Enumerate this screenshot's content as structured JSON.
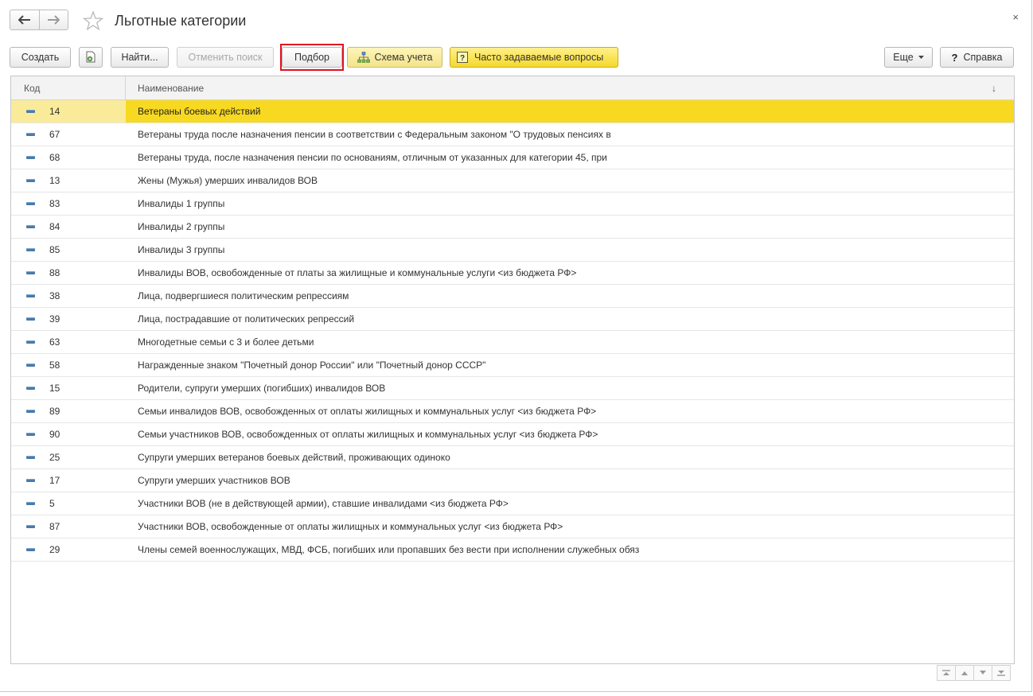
{
  "window": {
    "title": "Льготные категории",
    "close_label": "×"
  },
  "toolbar": {
    "create_label": "Создать",
    "find_label": "Найти...",
    "cancel_search_label": "Отменить поиск",
    "selection_label": "Подбор",
    "accounting_scheme_label": "Схема учета",
    "faq_label": "Часто задаваемые вопросы",
    "more_label": "Еще",
    "help_label": "Справка"
  },
  "table": {
    "columns": {
      "code": "Код",
      "name": "Наименование",
      "sort_indicator": "↓"
    },
    "rows": [
      {
        "code": "14",
        "name": "Ветераны боевых действий"
      },
      {
        "code": "67",
        "name": "Ветераны труда после назначения  пенсии в соответствии с Федеральным законом  \"О трудовых пенсиях в"
      },
      {
        "code": "68",
        "name": "Ветераны труда, после назначения пенсии по основаниям, отличным от указанных для  категории 45,  при"
      },
      {
        "code": "13",
        "name": "Жены (Мужья) умерших инвалидов ВОВ"
      },
      {
        "code": "83",
        "name": "Инвалиды 1 группы"
      },
      {
        "code": "84",
        "name": "Инвалиды 2 группы"
      },
      {
        "code": "85",
        "name": "Инвалиды 3 группы"
      },
      {
        "code": "88",
        "name": "Инвалиды ВОВ, освобожденные от платы за жилищные и коммунальные услуги <из бюджета РФ>"
      },
      {
        "code": "38",
        "name": "Лица, подвергшиеся политическим репрессиям"
      },
      {
        "code": "39",
        "name": "Лица, пострадавшие от политических репрессий"
      },
      {
        "code": "63",
        "name": "Многодетные семьи с 3 и более детьми"
      },
      {
        "code": "58",
        "name": "Награжденные знаком \"Почетный донор России\" или \"Почетный донор СССР\""
      },
      {
        "code": "15",
        "name": "Родители, супруги умерших (погибших) инвалидов ВОВ"
      },
      {
        "code": "89",
        "name": "Семьи инвалидов ВОВ, освобожденных от оплаты жилищных и коммунальных услуг <из бюджета РФ>"
      },
      {
        "code": "90",
        "name": "Семьи участников ВОВ, освобожденных от оплаты жилищных и коммунальных услуг <из бюджета РФ>"
      },
      {
        "code": "25",
        "name": "Супруги умерших ветеранов боевых действий, проживающих одиноко"
      },
      {
        "code": "17",
        "name": "Супруги умерших участников ВОВ"
      },
      {
        "code": "5",
        "name": "Участники ВОВ (не в действующей армии), ставшие инвалидами <из бюджета РФ>"
      },
      {
        "code": "87",
        "name": "Участники ВОВ, освобожденные от оплаты жилищных и коммунальных услуг <из бюджета РФ>"
      },
      {
        "code": "29",
        "name": "Члены семей военнослужащих, МВД, ФСБ, погибших или пропавших без вести при исполнении служебных обяз"
      }
    ],
    "selected_index": 0
  },
  "colors": {
    "selected_row": "#f8d921",
    "selected_code_cell": "#faeb9a",
    "highlight_frame": "#e3101d",
    "faq_button": "#f5d92b"
  },
  "icons": {
    "back": "arrow-left-icon",
    "forward": "arrow-right-icon",
    "favorite": "star-icon",
    "copy": "copy-document-icon",
    "scheme": "hierarchy-icon",
    "faq": "question-box-icon",
    "more": "dropdown-caret-icon",
    "help": "question-mark-icon",
    "row_marker": "item-dash-icon"
  }
}
